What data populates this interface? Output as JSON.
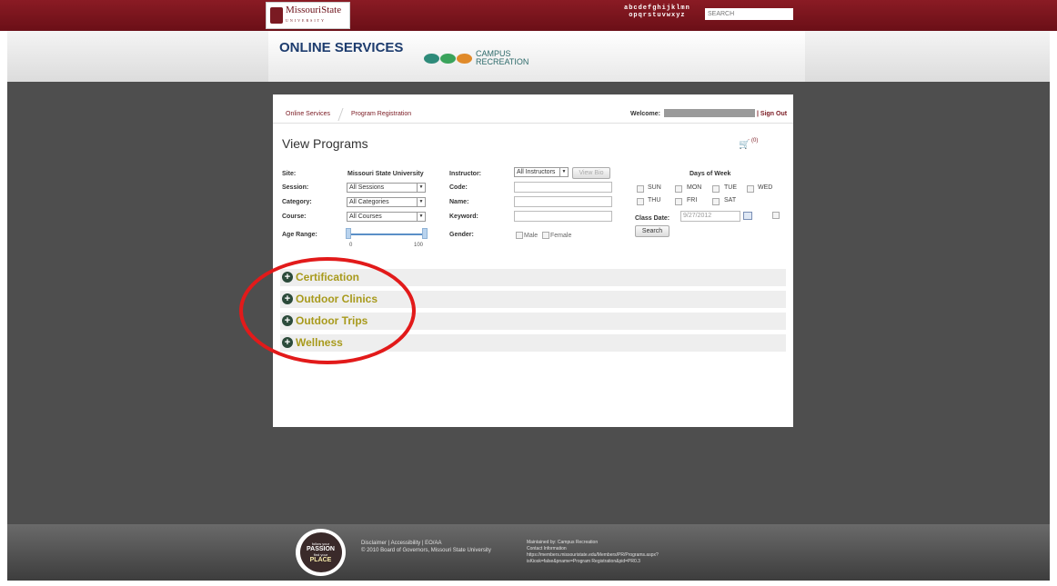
{
  "topbar": {
    "logo_text": "MissouriState",
    "logo_sub": "UNIVERSITY",
    "alpha_row1": "abcdefghijklmn",
    "alpha_row2": "opqrstuvwxyz",
    "search_placeholder": "SEARCH"
  },
  "header": {
    "title": "ONLINE SERVICES",
    "campus_line1": "CAMPUS",
    "campus_line2": "RECREATION"
  },
  "breadcrumb": {
    "item1": "Online Services",
    "item2": "Program Registration"
  },
  "user": {
    "welcome_label": "Welcome:",
    "signout": "| Sign Out"
  },
  "page": {
    "title": "View Programs",
    "cart_count": "(0)"
  },
  "filters": {
    "site_label": "Site:",
    "site_value": "Missouri State University",
    "session_label": "Session:",
    "session_value": "All Sessions",
    "category_label": "Category:",
    "category_value": "All Categories",
    "course_label": "Course:",
    "course_value": "All Courses",
    "age_label": "Age Range:",
    "age_min": "0",
    "age_max": "100",
    "instructor_label": "Instructor:",
    "instructor_value": "All Instructors",
    "view_bio": "View Bio",
    "code_label": "Code:",
    "name_label": "Name:",
    "keyword_label": "Keyword:",
    "gender_label": "Gender:",
    "male": "Male",
    "female": "Female",
    "days_title": "Days of Week",
    "days": [
      "SUN",
      "MON",
      "TUE",
      "WED",
      "THU",
      "FRI",
      "SAT"
    ],
    "class_date_label": "Class Date:",
    "class_date_value": "9/27/2012",
    "search_button": "Search"
  },
  "categories": [
    "Certification",
    "Outdoor Clinics",
    "Outdoor Trips",
    "Wellness"
  ],
  "footer": {
    "badge_line1": "follow your",
    "badge_line2": "PASSION",
    "badge_line3": "find your",
    "badge_line4": "PLACE",
    "links": "Disclaimer  |  Accessibility  |  EO/AA",
    "copyright": "© 2010 Board of Governors, Missouri State University",
    "maintained": "Maintained by: Campus Recreation",
    "contact": "Contact Information",
    "url1": "https://members.missouristate.edu/Members/PR/Programs.aspx?",
    "url2": "isKiosk=false&pname=Program Registration&pid=PR0.3"
  },
  "colors": {
    "maroon": "#7a1a22",
    "category_text": "#a89a1c",
    "annotation_red": "#e21a1a"
  }
}
